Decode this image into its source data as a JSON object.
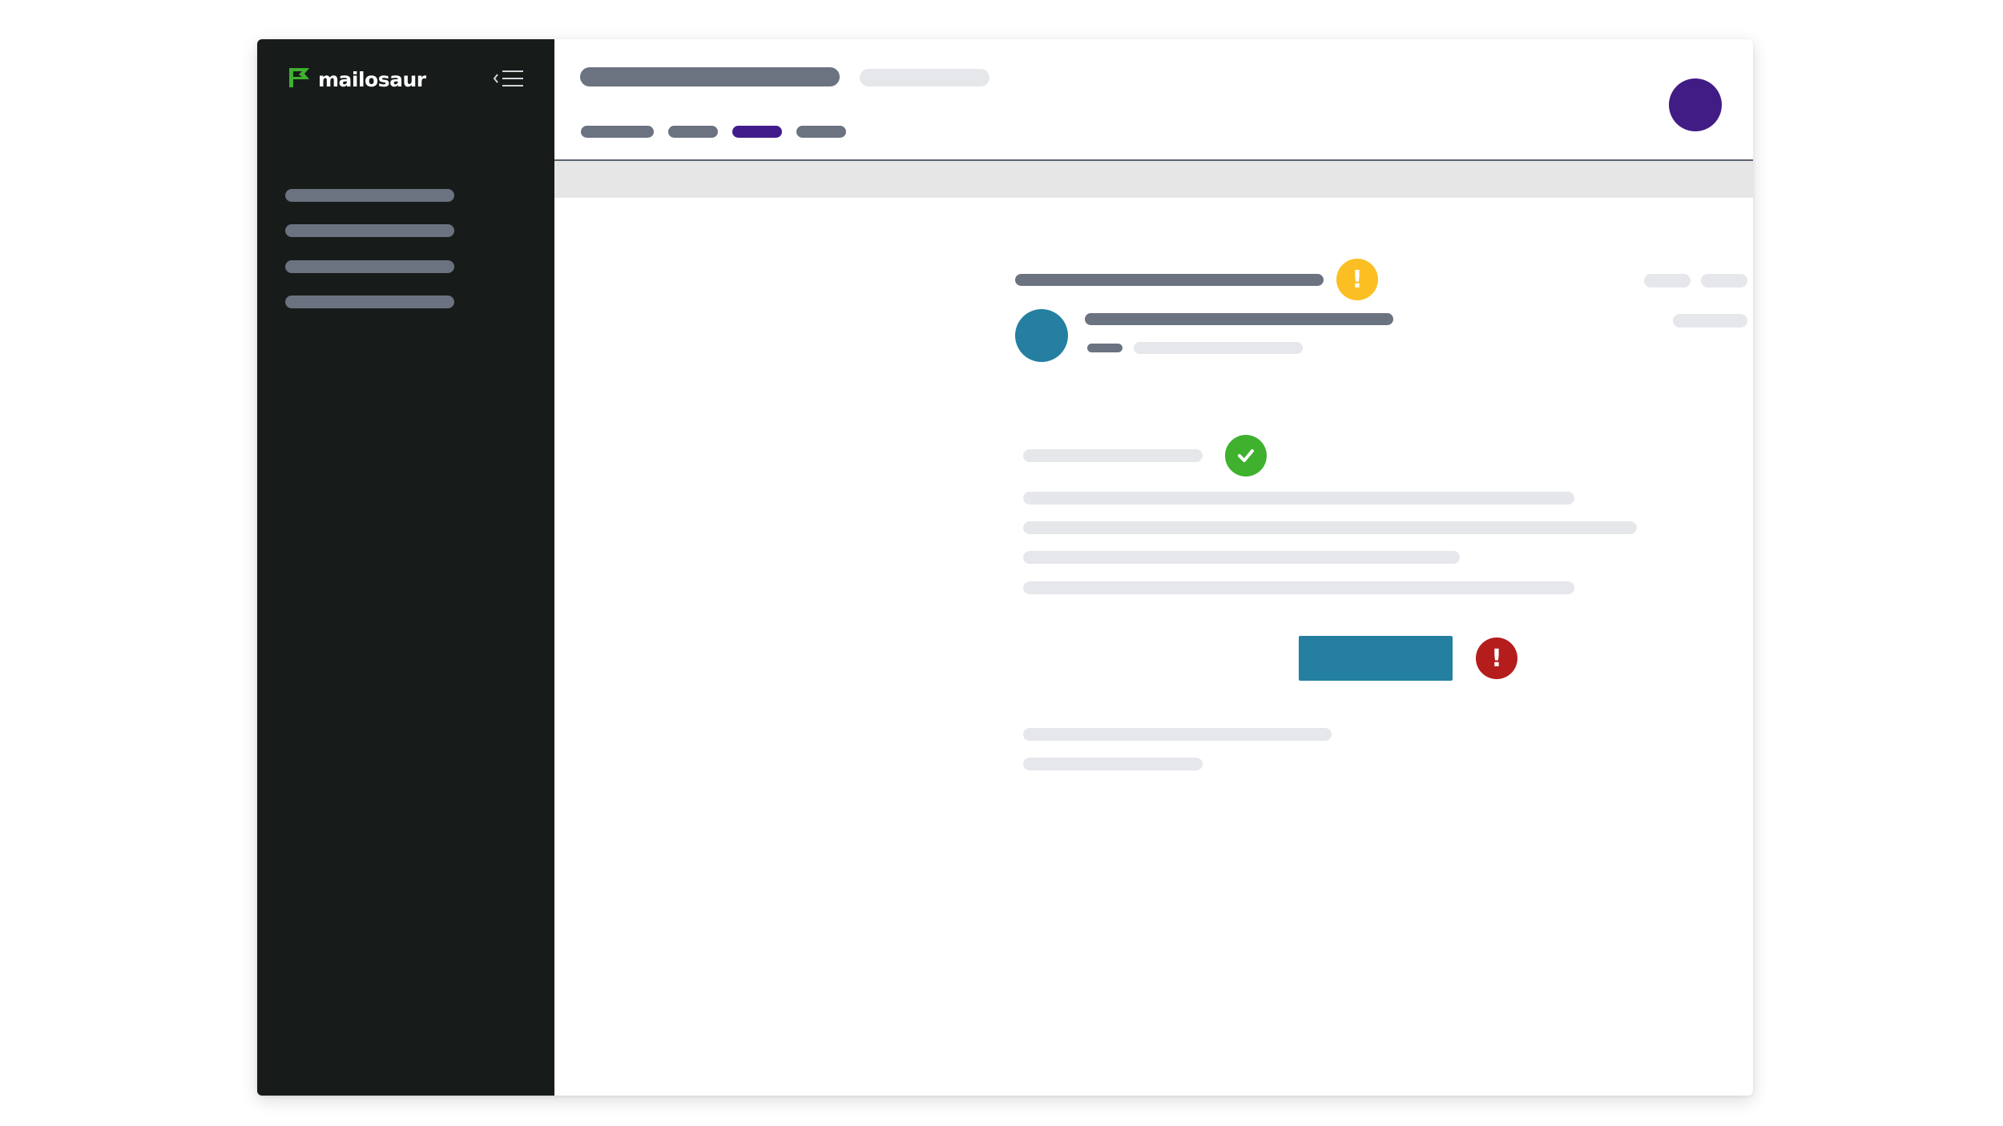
{
  "brand": {
    "name": "mailosaur",
    "accent_color": "#3fb12f",
    "logo_icon": "flag-logo-icon"
  },
  "colors": {
    "sidebar_bg": "#171c1a",
    "placeholder_dark": "#6b7280",
    "placeholder_light": "#e5e7eb",
    "active_tab": "#431c8b",
    "avatar": "#421c85",
    "sender_avatar": "#247fa1",
    "cta_button": "#247fa1",
    "warning": "#fbbf24",
    "success": "#3fb12f",
    "error": "#b51d1d"
  },
  "sidebar": {
    "collapse_icon": "menu-collapse-icon",
    "nav_item_count": 4
  },
  "header": {
    "tab_count": 4,
    "active_tab_index": 2,
    "user_avatar": "avatar"
  },
  "message": {
    "subject_status_icon": "warning-icon",
    "meta_status_icon": "check-icon",
    "section_status_icon": "check-icon",
    "button_status_icon": "error-icon"
  },
  "status_glyphs": {
    "warning": "!",
    "error": "!"
  }
}
